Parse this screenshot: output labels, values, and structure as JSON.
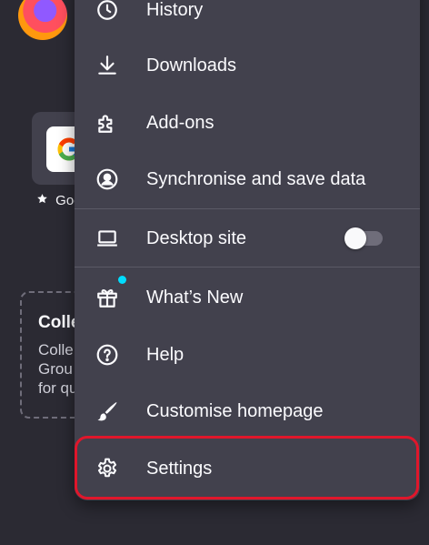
{
  "background": {
    "shortcut_label": "Goo",
    "collections": {
      "title": "Colle",
      "text": "Colle\nGrou\nfor qu"
    }
  },
  "menu": {
    "items": [
      {
        "label": "History",
        "icon": "history-icon"
      },
      {
        "label": "Downloads",
        "icon": "download-icon"
      },
      {
        "label": "Add-ons",
        "icon": "puzzle-icon"
      },
      {
        "label": "Synchronise and save data",
        "icon": "account-icon"
      },
      {
        "label": "Desktop site",
        "icon": "laptop-icon",
        "toggle": false
      },
      {
        "label": "What’s New",
        "icon": "gift-icon",
        "badge": true
      },
      {
        "label": "Help",
        "icon": "help-icon"
      },
      {
        "label": "Customise homepage",
        "icon": "brush-icon"
      },
      {
        "label": "Settings",
        "icon": "gear-icon",
        "highlighted": true
      }
    ]
  },
  "colors": {
    "background": "#2b2a33",
    "menu": "#42414d",
    "text": "#fbfbfe",
    "highlight_border": "#e0162b",
    "badge": "#00ddff"
  }
}
